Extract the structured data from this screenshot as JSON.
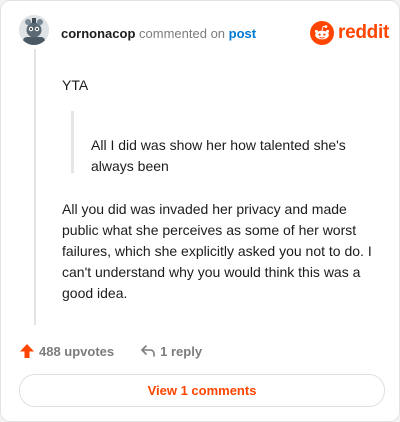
{
  "header": {
    "username": "cornonacop",
    "action_text": "commented on",
    "post_link": "post",
    "logo_text": "reddit"
  },
  "comment": {
    "opening": "YTA",
    "quote": "All I did was show her how talented she's always been",
    "body": "All you did was invaded her privacy and made public what she perceives as some of her worst failures, which she explicitly asked you not to do. I can't understand why you would think this was a good idea."
  },
  "footer": {
    "upvotes": "488 upvotes",
    "replies": "1 reply"
  },
  "view_button": {
    "label": "View 1 comments"
  },
  "colors": {
    "accent": "#ff4500",
    "link": "#0079d3"
  },
  "icons": [
    "avatar",
    "reddit-logo-icon",
    "upvote-arrow-icon",
    "reply-arrow-icon"
  ]
}
